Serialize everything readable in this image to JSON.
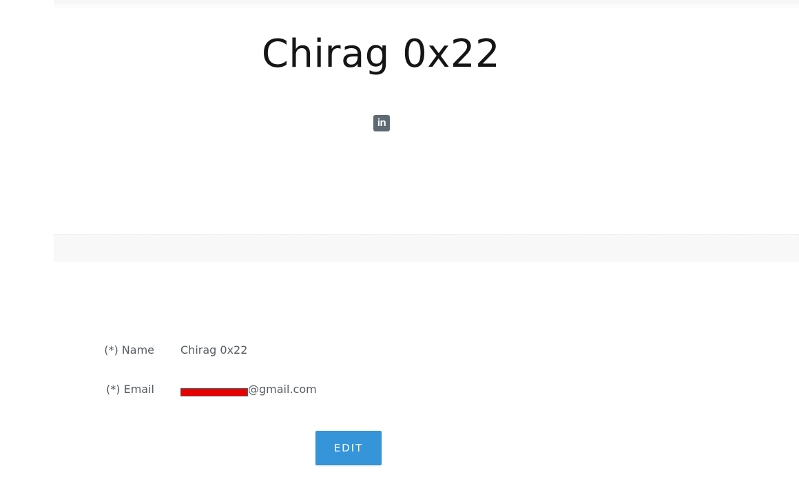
{
  "profile": {
    "name": "Chirag 0x22",
    "social_icon": "linkedin-icon",
    "social_glyph": "in"
  },
  "form": {
    "name_label": "(*) Name",
    "name_value": "Chirag 0x22",
    "email_label": "(*) Email",
    "email_value_suffix": "@gmail.com"
  },
  "actions": {
    "edit_label": "EDIT"
  },
  "colors": {
    "button": "#3595d8",
    "text": "#555c62",
    "heading": "#151515",
    "redaction": "#e60000"
  }
}
